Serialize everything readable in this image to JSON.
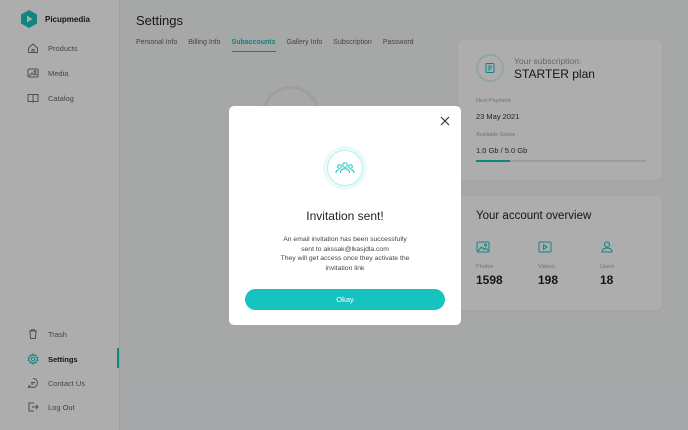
{
  "brand": {
    "name": "Picupmedia",
    "color": "#16c4bf"
  },
  "sidebar": {
    "items": [
      {
        "label": "Products",
        "icon": "home-icon"
      },
      {
        "label": "Media",
        "icon": "image-icon"
      },
      {
        "label": "Catalog",
        "icon": "book-icon"
      },
      {
        "label": "Trash",
        "icon": "trash-icon"
      },
      {
        "label": "Settings",
        "icon": "gear-icon"
      },
      {
        "label": "Contact Us",
        "icon": "chat-icon"
      },
      {
        "label": "Log Out",
        "icon": "logout-icon"
      }
    ],
    "active": "Settings"
  },
  "page": {
    "title": "Settings"
  },
  "tabs": [
    {
      "label": "Personal Info"
    },
    {
      "label": "Billing Info"
    },
    {
      "label": "Subaccounts"
    },
    {
      "label": "Gallery Info"
    },
    {
      "label": "Subscription"
    },
    {
      "label": "Password"
    }
  ],
  "active_tab": "Subaccounts",
  "subscription": {
    "label": "Your subscription:",
    "plan": "STARTER plan",
    "next_payment_label": "Next Payment",
    "next_payment": "23 May 2021",
    "space_label": "Available Space",
    "space": "1.0 Gb / 5.0 Gb",
    "space_fraction": 0.2
  },
  "overview": {
    "title": "Your account overview",
    "stats": [
      {
        "label": "Photos",
        "value": "1598",
        "icon": "photo-icon"
      },
      {
        "label": "Videos",
        "value": "198",
        "icon": "video-icon"
      },
      {
        "label": "Users",
        "value": "18",
        "icon": "user-icon"
      }
    ]
  },
  "modal": {
    "title": "Invitation sent!",
    "line1": "An email invitation has been successfully",
    "line2_prefix": "sent to ",
    "email": "akssak@lkasjdla.com",
    "line3": "They will get access once they activate the",
    "line4": "invitation link",
    "button": "Okay",
    "icon": "users-icon"
  }
}
